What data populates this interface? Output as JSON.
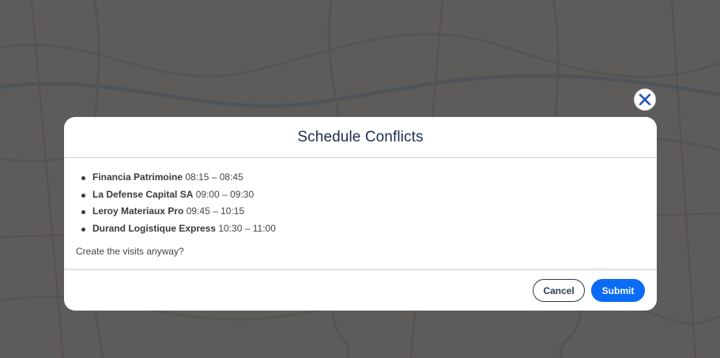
{
  "dialog": {
    "title": "Schedule Conflicts",
    "conflicts": [
      {
        "name": "Financia Patrimoine",
        "time": "08:15 – 08:45"
      },
      {
        "name": "La Defense Capital SA",
        "time": "09:00 – 09:30"
      },
      {
        "name": "Leroy Materiaux Pro",
        "time": "09:45 – 10:15"
      },
      {
        "name": "Durand Logistique Express",
        "time": "10:30 – 11:00"
      }
    ],
    "prompt": "Create the visits anyway?",
    "cancel_label": "Cancel",
    "submit_label": "Submit"
  },
  "colors": {
    "accent": "#0a6cf5",
    "title": "#1c2f4a",
    "overlay": "rgba(40,40,40,0.72)"
  },
  "icons": {
    "close": "close-icon"
  }
}
